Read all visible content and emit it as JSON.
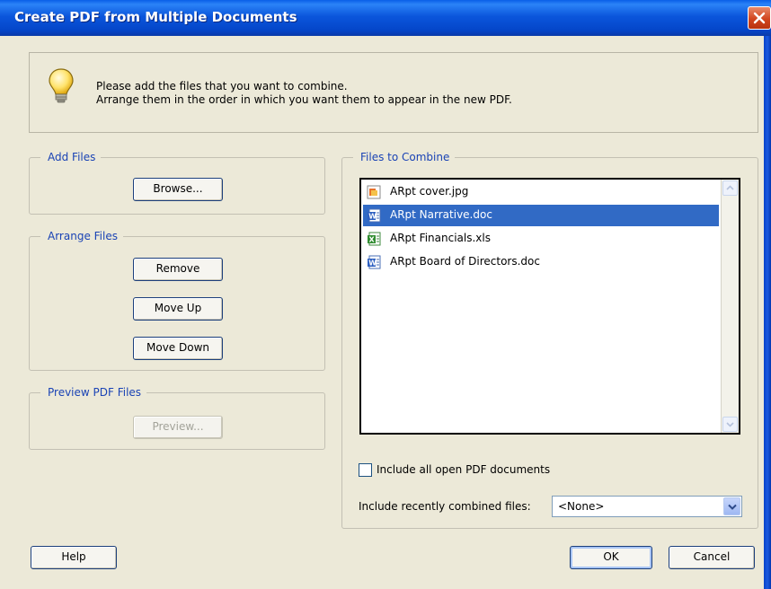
{
  "window": {
    "title": "Create PDF from Multiple Documents"
  },
  "info": {
    "line1": "Please add the files that you want to combine.",
    "line2": "Arrange them in the order in which you want them to appear in the new PDF."
  },
  "add_files": {
    "legend": "Add Files",
    "browse_label": "Browse..."
  },
  "arrange_files": {
    "legend": "Arrange Files",
    "remove_label": "Remove",
    "move_up_label": "Move Up",
    "move_down_label": "Move Down"
  },
  "preview_files": {
    "legend": "Preview PDF Files",
    "preview_label": "Preview..."
  },
  "combine": {
    "legend": "Files to Combine",
    "files": [
      {
        "name": "ARpt cover.jpg",
        "icon": "image-file-icon",
        "selected": false
      },
      {
        "name": "ARpt Narrative.doc",
        "icon": "word-file-icon",
        "selected": true
      },
      {
        "name": "ARpt Financials.xls",
        "icon": "excel-file-icon",
        "selected": false
      },
      {
        "name": "ARpt Board of Directors.doc",
        "icon": "word-file-icon",
        "selected": false
      }
    ],
    "include_open_label": "Include all open PDF documents",
    "include_open_checked": false,
    "recent_label": "Include recently combined files:",
    "recent_value": "<None>"
  },
  "footer": {
    "help_label": "Help",
    "ok_label": "OK",
    "cancel_label": "Cancel"
  },
  "colors": {
    "titlebar": "#0a55d8",
    "selection": "#316ac5",
    "legend_text": "#1a43b5",
    "dialog_bg": "#ece9d8"
  }
}
